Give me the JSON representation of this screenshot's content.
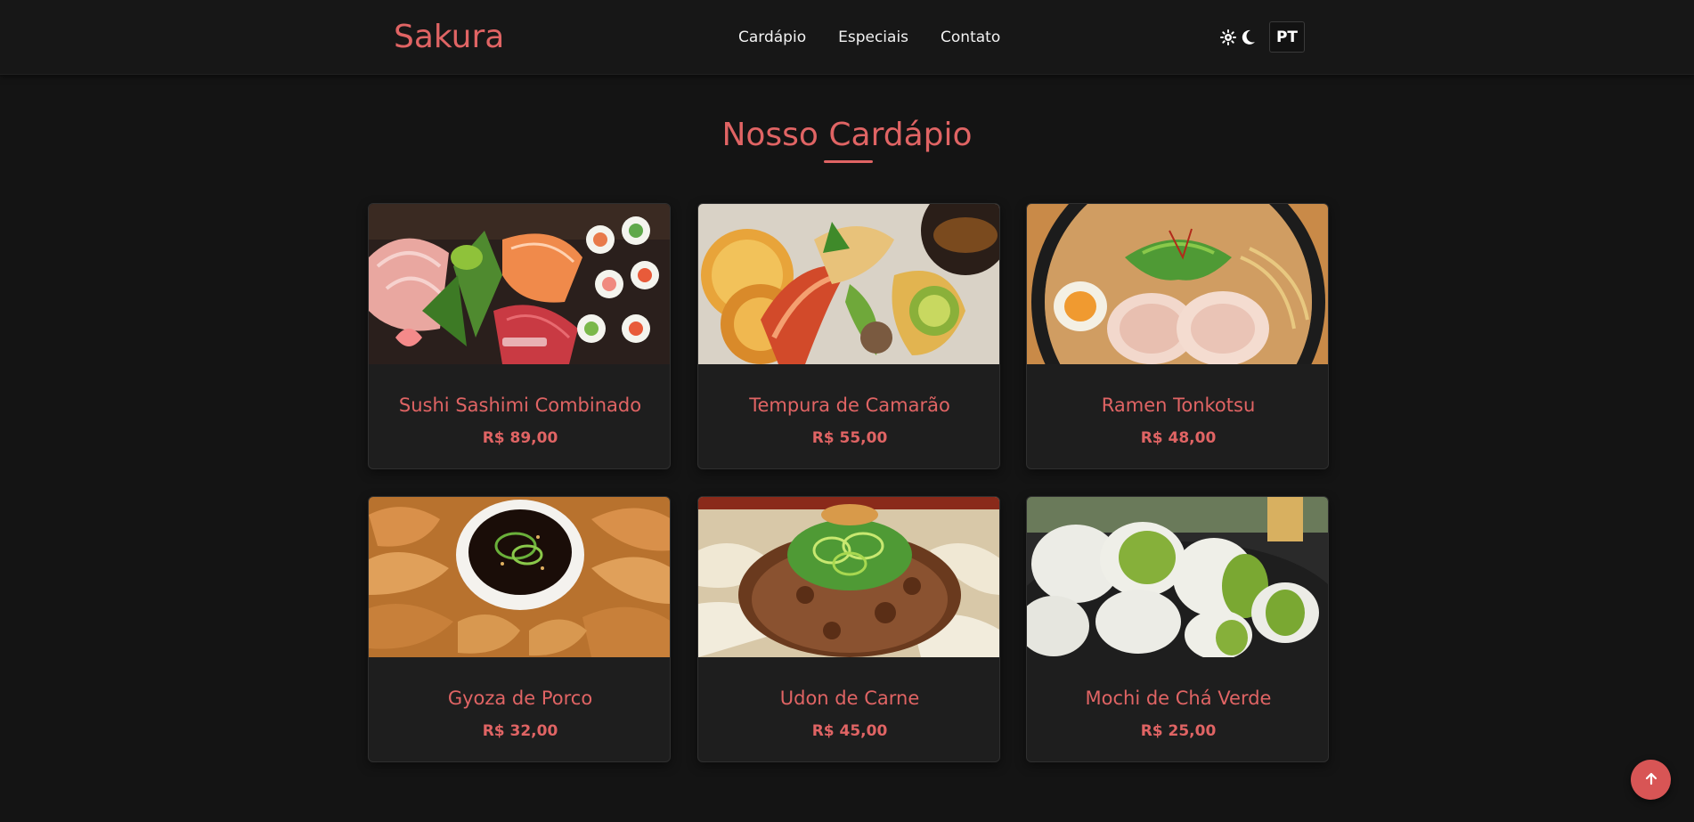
{
  "brand": {
    "name": "Sakura"
  },
  "nav": {
    "items": [
      "Cardápio",
      "Especiais",
      "Contato"
    ]
  },
  "header": {
    "theme_icons": [
      "sun-icon",
      "moon-icon"
    ],
    "language": "PT"
  },
  "menu": {
    "title": "Nosso Cardápio",
    "items": [
      {
        "name": "Sushi Sashimi Combinado",
        "price": "R$ 89,00"
      },
      {
        "name": "Tempura de Camarão",
        "price": "R$ 55,00"
      },
      {
        "name": "Ramen Tonkotsu",
        "price": "R$ 48,00"
      },
      {
        "name": "Gyoza de Porco",
        "price": "R$ 32,00"
      },
      {
        "name": "Udon de Carne",
        "price": "R$ 45,00"
      },
      {
        "name": "Mochi de Chá Verde",
        "price": "R$ 25,00"
      }
    ]
  },
  "back_to_top": {
    "icon": "arrow-up-icon"
  },
  "colors": {
    "accent": "#e06464",
    "background": "#141414",
    "card": "#1e1e1e"
  }
}
